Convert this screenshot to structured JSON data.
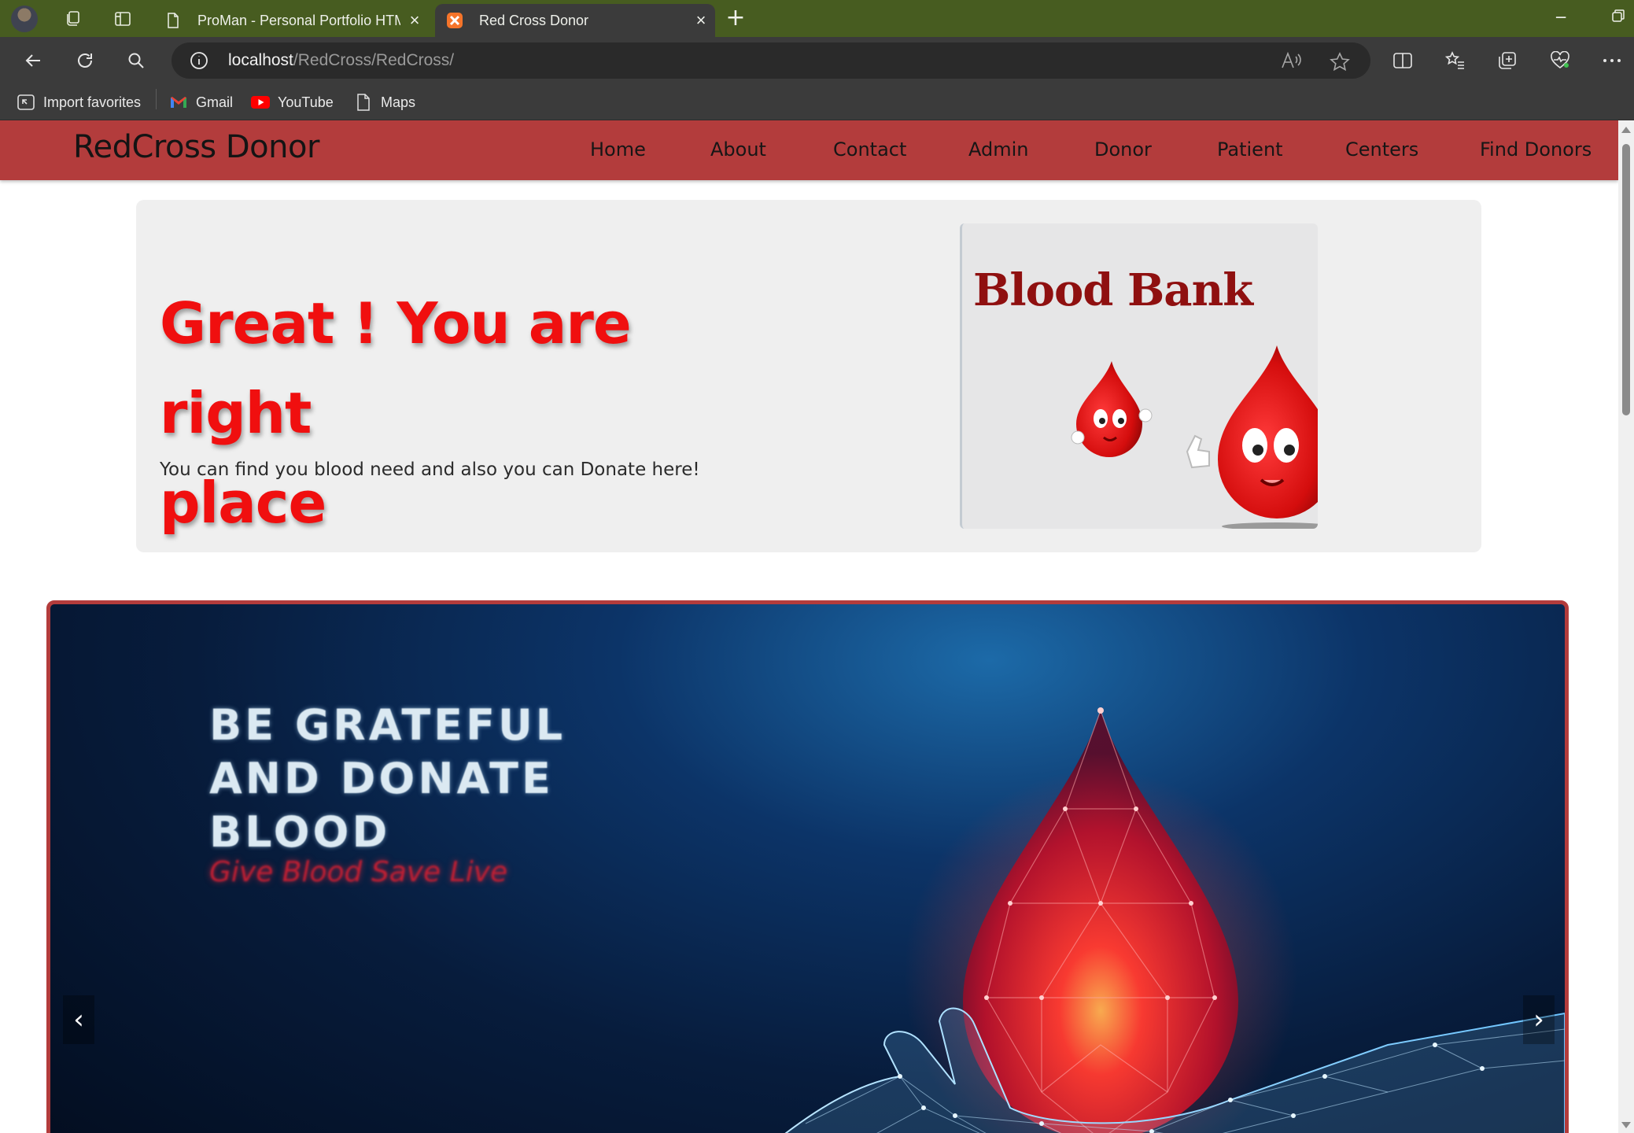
{
  "browser": {
    "tabs": [
      {
        "title": "ProMan - Personal Portfolio HTML",
        "active": false
      },
      {
        "title": "Red Cross Donor",
        "active": true
      }
    ],
    "url_host": "localhost",
    "url_path": "/RedCross/RedCross/",
    "favorites": [
      "Import favorites",
      "Gmail",
      "YouTube",
      "Maps"
    ]
  },
  "site": {
    "brand": "RedCross Donor",
    "nav": [
      "Home",
      "About",
      "Contact",
      "Admin",
      "Donor",
      "Patient",
      "Centers",
      "Find Donors"
    ]
  },
  "hero": {
    "title_line1": "Great ! You are right",
    "title_line2": "place",
    "subtitle": "You can find you blood need and also you can Donate here!",
    "image_title": "Blood Bank"
  },
  "carousel": {
    "slide_line1": "BE GRATEFUL",
    "slide_line2": "AND DONATE",
    "slide_line3": "BLOOD",
    "slide_tagline": "Give Blood  Save Live",
    "prev_label": "‹",
    "next_label": "›"
  },
  "colors": {
    "nav_bg": "#b33c3c",
    "hero_title": "#f00f0f",
    "tabbar_bg": "#475c20",
    "toolbar_bg": "#3b3b3b"
  }
}
